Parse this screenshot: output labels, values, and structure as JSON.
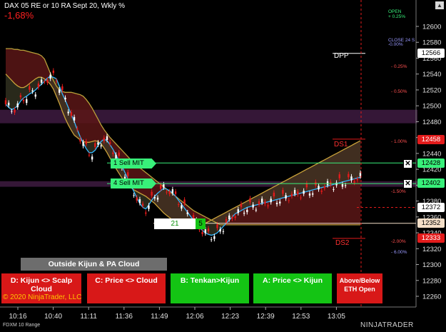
{
  "header": {
    "title": "DAX 05 RE or 10 RA Sept 20, Wkly %",
    "change": "-1,68%"
  },
  "price_axis": {
    "ticks": [
      "12600",
      "12580",
      "12560",
      "12540",
      "12520",
      "12500",
      "12480",
      "12460",
      "12440",
      "12420",
      "12400",
      "12380",
      "12360",
      "12340",
      "12320",
      "12300",
      "12280",
      "12260"
    ]
  },
  "price_tags": {
    "last_high": "12566",
    "ds1": "12458",
    "mit1": "12428",
    "mit4": "12402",
    "current": "12372",
    "level_tan": "12352",
    "ds2": "12333"
  },
  "pct_labels": {
    "open": "OPEN",
    "open_pct": "+ 0.25%",
    "close": "CLOSE 24 S",
    "p1": "-0.00%",
    "p2": "- 0.25%",
    "p3": "- 0.50%",
    "p4": "- 1.00%",
    "p5": "-1.50%",
    "p6": "-2.00%",
    "p7": "- 6.00%"
  },
  "level_labels": {
    "dpp": "DPP",
    "ds1": "DS1",
    "ds2": "DS2"
  },
  "orders": {
    "mit1": "1 Sell MIT",
    "mit4": "4 Sell MIT",
    "close_icon": "✕"
  },
  "order_box": {
    "qty": "21",
    "count": "5"
  },
  "buttons": {
    "cloud": "Outside Kijun & PA Cloud",
    "d": "D: Kijun <> Scalp Cloud",
    "c": "C: Price <> Cloud",
    "b": "B: Tenkan>Kijun",
    "a": "A: Price <> Kijun",
    "eth": "Above/Below ETH Open"
  },
  "time_axis": {
    "ticks": [
      "10:16",
      "10:40",
      "11:11",
      "11:36",
      "11:49",
      "12:06",
      "12:23",
      "12:39",
      "12:53",
      "13:05"
    ]
  },
  "footer": {
    "copyright": "© 2020 NinjaTrader, LLC",
    "instrument": "FDXM 10 Range",
    "brand": "NINJATRADER"
  },
  "chart_data": {
    "type": "line",
    "ylim": [
      12250,
      12615
    ],
    "x": [
      0,
      1,
      2,
      3,
      4,
      5,
      6,
      7,
      8,
      9,
      10,
      11,
      12,
      13,
      14,
      15,
      16,
      17,
      18,
      19,
      20,
      21,
      22,
      23,
      24,
      25,
      26,
      27,
      28,
      29,
      30,
      31,
      32,
      33,
      34,
      35,
      36,
      37,
      38,
      39,
      40,
      41,
      42,
      43,
      44,
      45,
      46,
      47,
      48,
      49,
      50,
      51,
      52,
      53,
      54,
      55,
      56,
      57,
      58,
      59,
      60,
      61,
      62,
      63,
      64,
      65,
      66,
      67,
      68,
      69,
      70,
      71,
      72,
      73,
      74,
      75,
      76,
      77,
      78,
      79,
      80,
      81,
      82,
      83,
      84,
      85,
      86,
      87,
      88,
      89,
      90,
      91,
      92,
      93,
      94,
      95,
      96,
      97,
      98,
      99,
      100,
      101,
      102,
      103,
      104,
      105,
      106,
      107,
      108,
      109,
      110,
      111,
      112,
      113,
      114,
      115,
      116,
      117,
      118,
      119
    ],
    "series": [
      {
        "values": [
          12502,
          12498,
          12495,
          12497,
          12500,
          12506,
          12510,
          12512,
          12515,
          12517,
          12520,
          12524,
          12527,
          12531,
          12535,
          12537,
          12536,
          12534,
          12525,
          12515,
          12507,
          12498,
          12489,
          12480,
          12470,
          12461,
          12453,
          12446,
          12441,
          12441,
          12444,
          12450,
          12455,
          12458,
          12456,
          12451,
          12445,
          12438,
          12431,
          12424,
          12416,
          12408,
          12400,
          12392,
          12384,
          12377,
          12372,
          12370,
          12375,
          12381,
          12386,
          12390,
          12393,
          12396,
          12395,
          12393,
          12390,
          12386,
          12381,
          12376,
          12371,
          12366,
          12361,
          12356,
          12351,
          12347,
          12343,
          12340,
          12338,
          12337,
          12338,
          12340,
          12344,
          12348,
          12352,
          12356,
          12360,
          12364,
          12366,
          12368,
          12370,
          12372,
          12373,
          12374,
          12375,
          12376,
          12377,
          12378,
          12379,
          12380,
          12381,
          12382,
          12383,
          12384,
          12385,
          12386,
          12387,
          12388,
          12389,
          12390,
          12391,
          12392,
          12393,
          12394,
          12395,
          12396,
          12397,
          12398,
          12399,
          12400,
          12401,
          12402,
          12403,
          12404,
          12405,
          12406,
          12407,
          12408,
          12409,
          12410
        ]
      },
      {
        "values": [
          12540,
          12536,
          12532,
          12528,
          12525,
          12523,
          12523,
          12525,
          12528,
          12531,
          12534,
          12536,
          12536,
          12534,
          12531,
          12527,
          12521,
          12512,
          12503,
          12493,
          12484,
          12476,
          12469,
          12463,
          12460,
          12457,
          12455,
          12454,
          12454,
          12455,
          12456,
          12455,
          12452,
          12447,
          12441,
          12434,
          12428,
          12421,
          12415,
          12409,
          12404,
          12400,
          12397,
          12394,
          12392,
          12390,
          12388,
          12386,
          12383,
          12380,
          12377,
          12373,
          12369,
          12365,
          12362,
          12359,
          12356,
          12353,
          12351,
          12349,
          12347,
          12346,
          12345,
          12345,
          12346,
          12348,
          12350,
          12352,
          12354,
          12356,
          12358,
          12360,
          12362,
          12364,
          12366,
          12368,
          12370,
          12372,
          12374,
          12376,
          12378,
          12380,
          12382,
          12384,
          12386,
          12388,
          12390,
          12392,
          12394,
          12396,
          12398,
          12400,
          12402,
          12404,
          12406,
          12408,
          12410,
          12412,
          12414,
          12416,
          12418,
          12420,
          12422,
          12424,
          12426,
          12428,
          12430,
          12432,
          12434,
          12436,
          12438,
          12440,
          12442,
          12444,
          12446,
          12448,
          12450,
          12452,
          12454,
          12456
        ]
      },
      {
        "values": [
          12572,
          12572,
          12572,
          12571,
          12571,
          12570,
          12570,
          12569,
          12568,
          12567,
          12566,
          12565,
          12563,
          12559,
          12550,
          12541,
          12532,
          12525,
          12520,
          12518,
          12517,
          12517,
          12517,
          12516,
          12515,
          12514,
          12512,
          12508,
          12503,
          12497,
          12490,
          12483,
          12476,
          12470,
          12465,
          12460,
          12456,
          12452,
          12448,
          12444,
          12440,
          12436,
          12432,
          12428,
          12425,
          12422,
          12419,
          12416,
          12413,
          12410,
          12407,
          12404,
          12401,
          12398,
          12395,
          12392,
          12389,
          12386,
          12383,
          12380,
          12377,
          12374,
          12371,
          12368,
          12366,
          12364,
          12362,
          12360,
          12358,
          12356,
          12354,
          12352,
          12350,
          12350,
          12350,
          12350,
          12350,
          12350,
          12350,
          12350,
          12350,
          12350,
          12350,
          12350,
          12350,
          12350,
          12350,
          12350,
          12350,
          12350,
          12350,
          12350,
          12350,
          12350,
          12350,
          12350,
          12350,
          12350,
          12350,
          12350,
          12350,
          12350,
          12350,
          12350,
          12350,
          12350,
          12350,
          12350,
          12350,
          12350,
          12350,
          12350,
          12350,
          12350,
          12350,
          12350,
          12350,
          12350,
          12350,
          12350
        ]
      }
    ]
  }
}
